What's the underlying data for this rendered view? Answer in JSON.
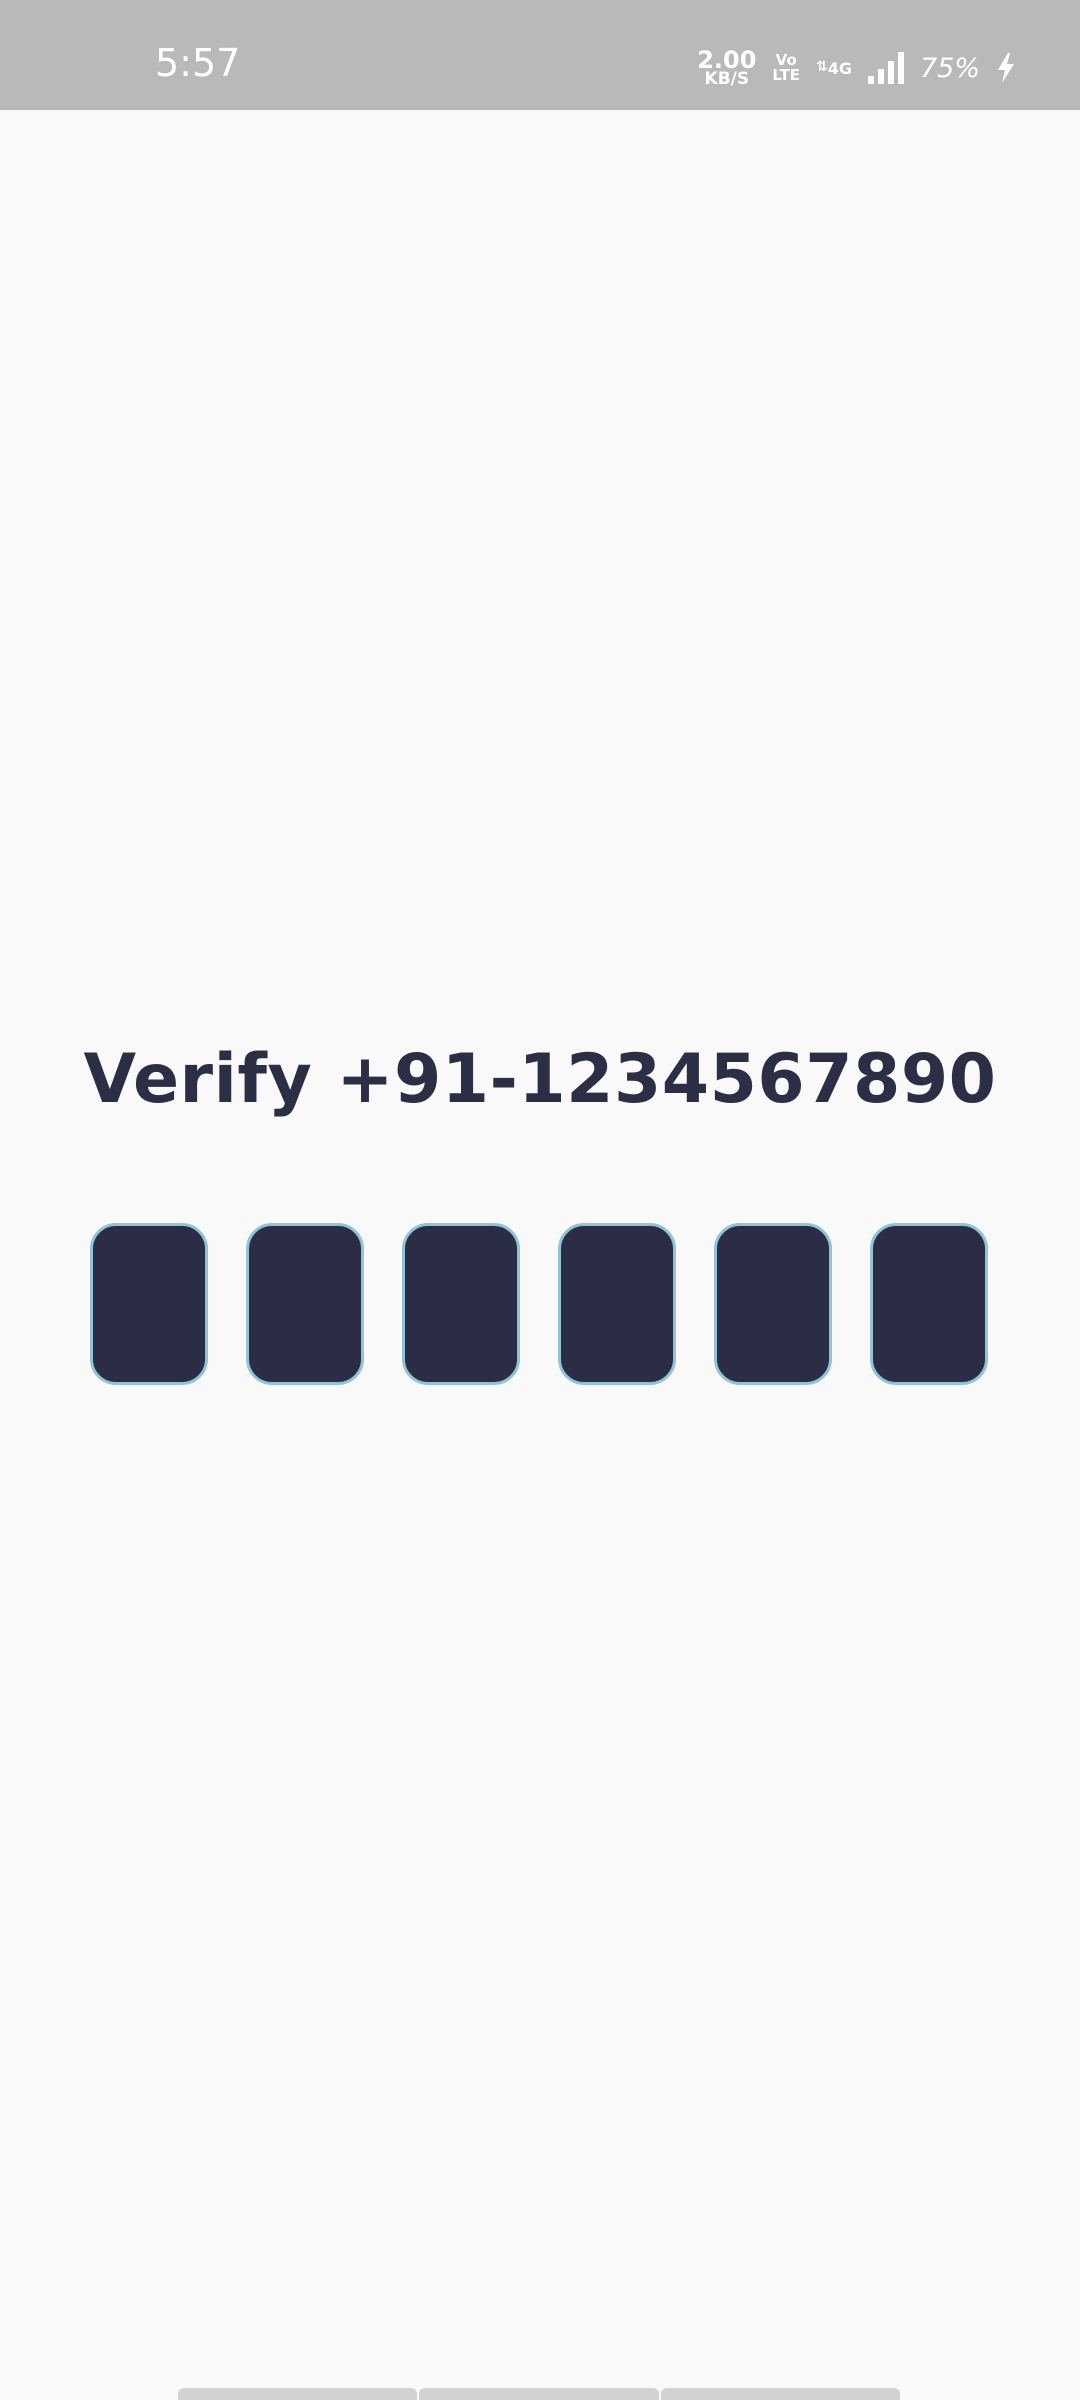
{
  "status_bar": {
    "time": "5:57",
    "net_speed_value": "2.00",
    "net_speed_unit": "KB/S",
    "volte_top": "Vo",
    "volte_bottom": "LTE",
    "network_type": "4G",
    "battery_percent": "75%",
    "icons": [
      "volte-icon",
      "network-4g-icon",
      "signal-icon",
      "charging-bolt-icon"
    ]
  },
  "verify": {
    "title": "Verify +91-1234567890",
    "otp_boxes": [
      "",
      "",
      "",
      "",
      "",
      ""
    ]
  },
  "colors": {
    "background": "#f9f9f9",
    "status_bar": "#b9b9b9",
    "title_text": "#2b2e45",
    "otp_fill": "#2a2d43",
    "otp_border": "#8fc4d6"
  }
}
